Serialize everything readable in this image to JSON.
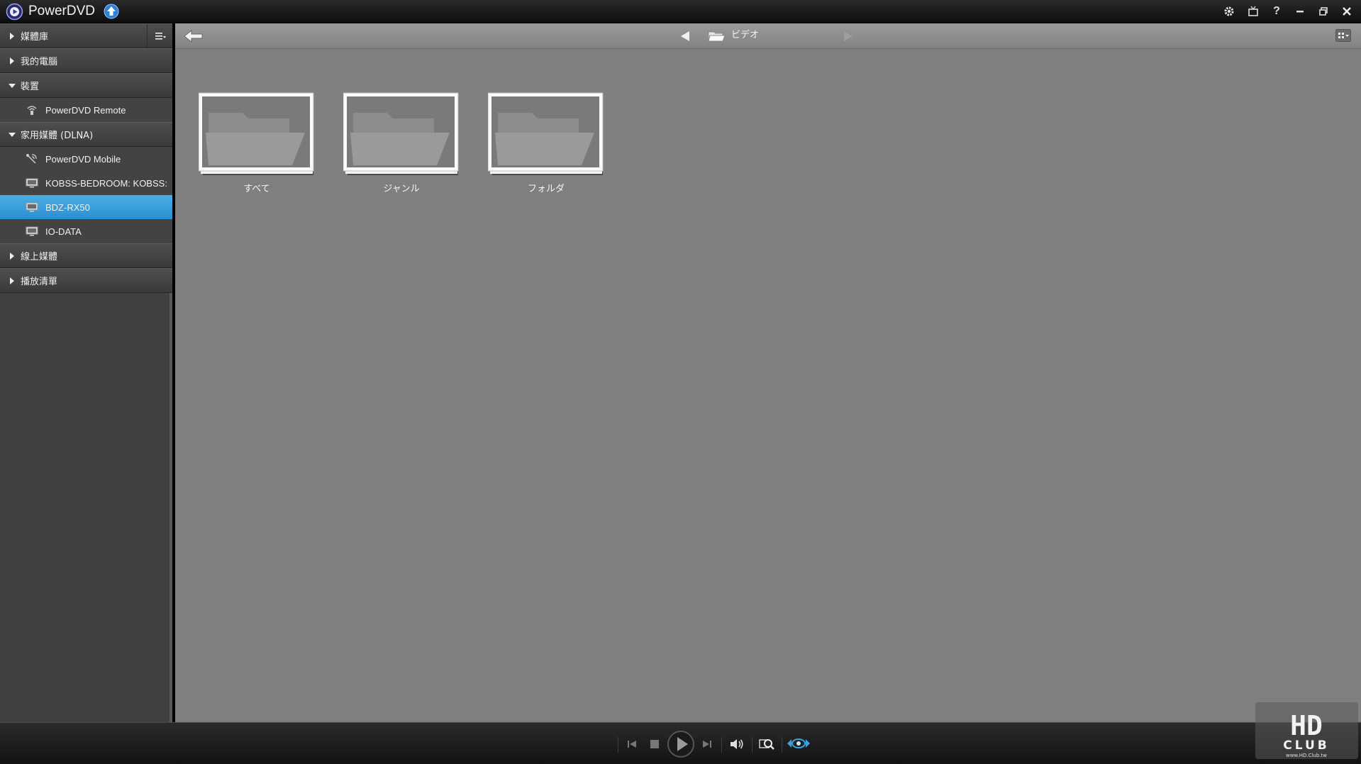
{
  "app": {
    "title": "PowerDVD"
  },
  "sidebar": {
    "sections": [
      {
        "label": "媒體庫",
        "expanded": false,
        "items": []
      },
      {
        "label": "我的電腦",
        "expanded": false,
        "items": []
      },
      {
        "label": "裝置",
        "expanded": true,
        "items": [
          {
            "label": "PowerDVD Remote",
            "icon": "remote-icon"
          }
        ]
      },
      {
        "label": "家用媒體 (DLNA)",
        "expanded": true,
        "items": [
          {
            "label": "PowerDVD Mobile",
            "icon": "mobile-icon"
          },
          {
            "label": "KOBSS-BEDROOM: KOBSS:",
            "icon": "monitor-icon"
          },
          {
            "label": "BDZ-RX50",
            "icon": "monitor-icon",
            "selected": true
          },
          {
            "label": "IO-DATA",
            "icon": "monitor-icon"
          }
        ]
      },
      {
        "label": "線上媒體",
        "expanded": false,
        "items": []
      },
      {
        "label": "播放清單",
        "expanded": false,
        "items": []
      }
    ]
  },
  "toolbar": {
    "breadcrumb": "ビデオ"
  },
  "folders": [
    {
      "label": "すべて"
    },
    {
      "label": "ジャンル"
    },
    {
      "label": "フォルダ"
    }
  ],
  "watermark": {
    "text": "HD CLUB",
    "url": "www.HD.Club.tw"
  },
  "colors": {
    "selection": "#2a8fd0",
    "accent_blue": "#35a3e0",
    "content_bg": "#7f7f7f"
  }
}
